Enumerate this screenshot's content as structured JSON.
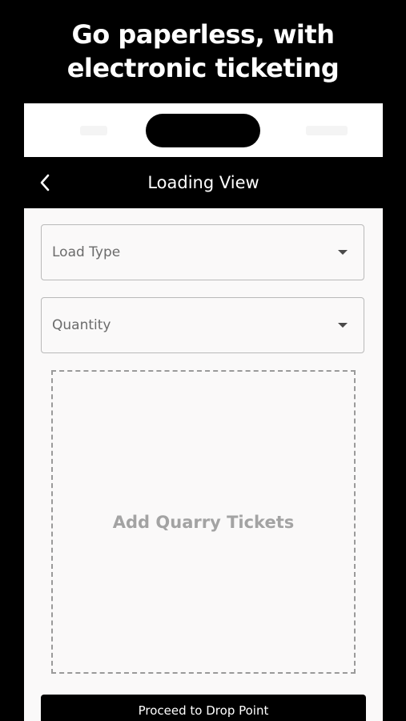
{
  "promo": {
    "headline_line1": "Go paperless, with",
    "headline_line2": "electronic ticketing"
  },
  "nav": {
    "title": "Loading View",
    "back_icon": "chevron-left-icon"
  },
  "form": {
    "load_type": {
      "placeholder": "Load Type",
      "icon": "caret-down-icon"
    },
    "quantity": {
      "placeholder": "Quantity",
      "icon": "caret-down-icon"
    },
    "ticket_upload_label": "Add Quarry Tickets"
  },
  "actions": {
    "proceed_label": "Proceed to Drop Point"
  },
  "colors": {
    "background": "#000000",
    "screen_background": "#faf9f9",
    "nav_background": "#000000",
    "field_border": "#b9b9b9",
    "placeholder_text": "#6b6b6b",
    "dashed_border": "#9a9a9a",
    "upload_label": "#a3a3a3",
    "primary_button": "#000000"
  }
}
